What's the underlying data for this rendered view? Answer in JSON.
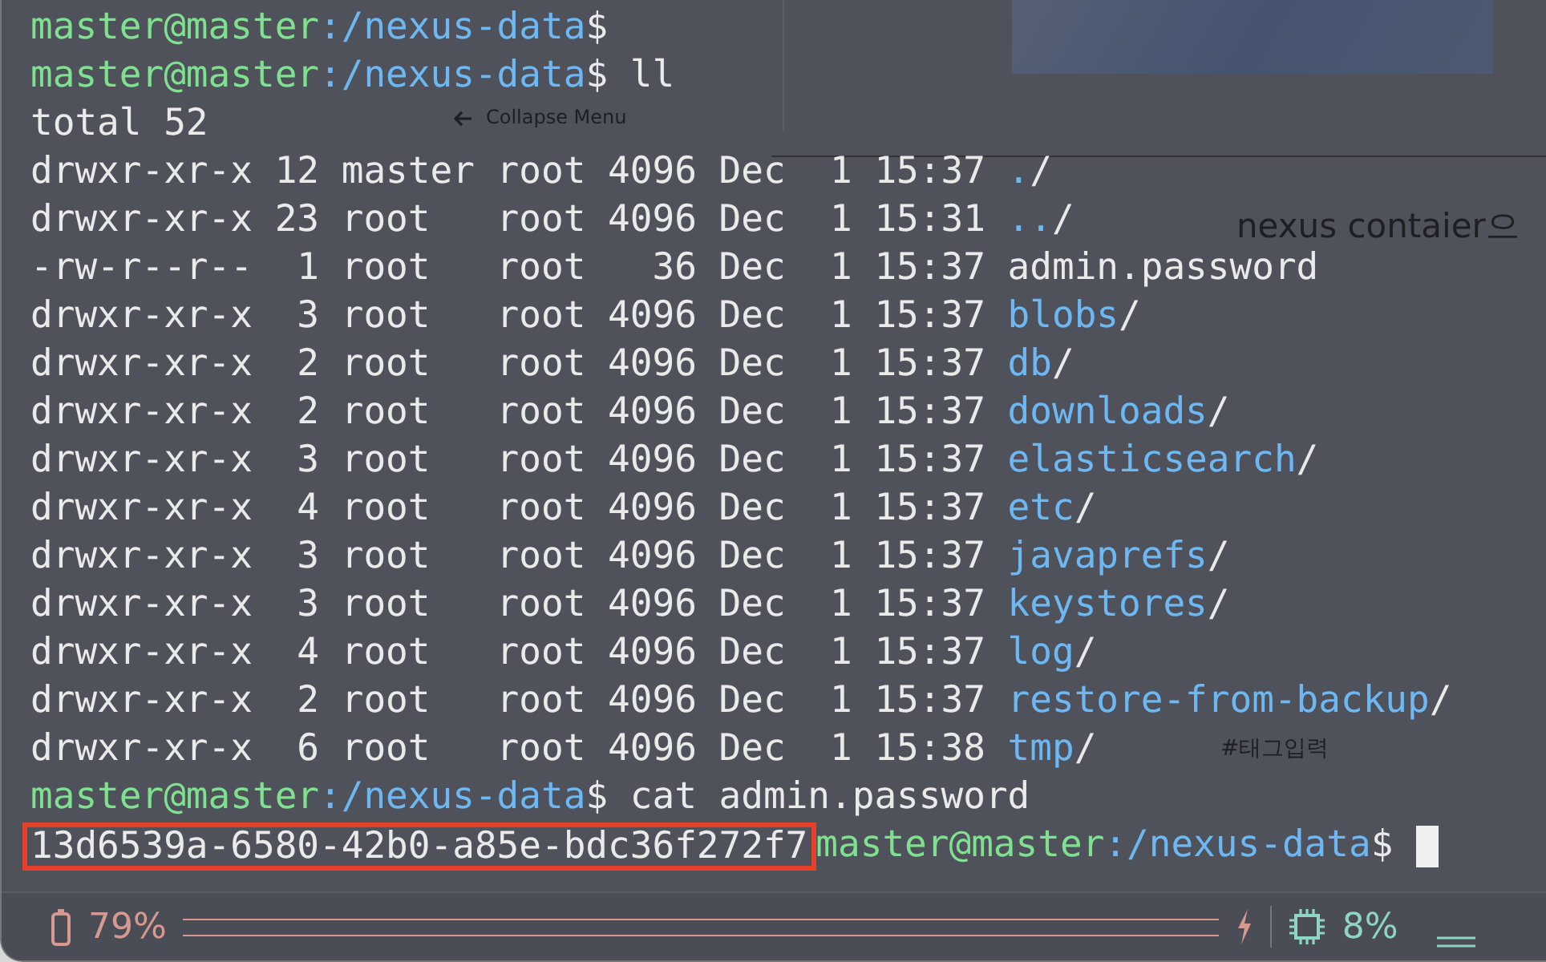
{
  "background_page": {
    "texts": [
      {
        "kind": "menu",
        "text": "Collapse Menu"
      },
      {
        "kind": "heading",
        "text": "nexus contaier으"
      },
      {
        "kind": "tag",
        "text": "#태그입력"
      }
    ]
  },
  "terminal": {
    "lines": [
      {
        "kind": "prompt",
        "user_host": "master@master",
        "path": ":/nexus-data",
        "symbol": "$"
      },
      {
        "kind": "prompt",
        "user_host": "master@master",
        "path": ":/nexus-data",
        "symbol": "$",
        "command": " ll"
      },
      {
        "kind": "output",
        "text": "total 52"
      },
      {
        "kind": "dir",
        "meta": "drwxr-xr-x 12 master root 4096 Dec  1 15:37 ",
        "name": ".",
        "suffix": "/"
      },
      {
        "kind": "dir",
        "meta": "drwxr-xr-x 23 root   root 4096 Dec  1 15:31 ",
        "name": "..",
        "suffix": "/"
      },
      {
        "kind": "file",
        "meta": "-rw-r--r--  1 root   root   36 Dec  1 15:37 ",
        "name": "admin.password"
      },
      {
        "kind": "dir",
        "meta": "drwxr-xr-x  3 root   root 4096 Dec  1 15:37 ",
        "name": "blobs",
        "suffix": "/"
      },
      {
        "kind": "dir",
        "meta": "drwxr-xr-x  2 root   root 4096 Dec  1 15:37 ",
        "name": "db",
        "suffix": "/"
      },
      {
        "kind": "dir",
        "meta": "drwxr-xr-x  2 root   root 4096 Dec  1 15:37 ",
        "name": "downloads",
        "suffix": "/"
      },
      {
        "kind": "dir",
        "meta": "drwxr-xr-x  3 root   root 4096 Dec  1 15:37 ",
        "name": "elasticsearch",
        "suffix": "/"
      },
      {
        "kind": "dir",
        "meta": "drwxr-xr-x  4 root   root 4096 Dec  1 15:37 ",
        "name": "etc",
        "suffix": "/"
      },
      {
        "kind": "dir",
        "meta": "drwxr-xr-x  3 root   root 4096 Dec  1 15:37 ",
        "name": "javaprefs",
        "suffix": "/"
      },
      {
        "kind": "dir",
        "meta": "drwxr-xr-x  3 root   root 4096 Dec  1 15:37 ",
        "name": "keystores",
        "suffix": "/"
      },
      {
        "kind": "dir",
        "meta": "drwxr-xr-x  4 root   root 4096 Dec  1 15:37 ",
        "name": "log",
        "suffix": "/"
      },
      {
        "kind": "dir",
        "meta": "drwxr-xr-x  2 root   root 4096 Dec  1 15:37 ",
        "name": "restore-from-backup",
        "suffix": "/"
      },
      {
        "kind": "dir",
        "meta": "drwxr-xr-x  6 root   root 4096 Dec  1 15:38 ",
        "name": "tmp",
        "suffix": "/"
      },
      {
        "kind": "prompt",
        "user_host": "master@master",
        "path": ":/nexus-data",
        "symbol": "$",
        "command": " cat admin.password"
      },
      {
        "kind": "result_prompt",
        "result": "13d6539a-6580-42b0-a85e-bdc36f272f7",
        "highlighted": true,
        "user_host": "master@master",
        "path": ":/nexus-data",
        "symbol": "$",
        "cursor": true
      }
    ]
  },
  "status_bar": {
    "battery": "79%",
    "cpu": "8%"
  }
}
